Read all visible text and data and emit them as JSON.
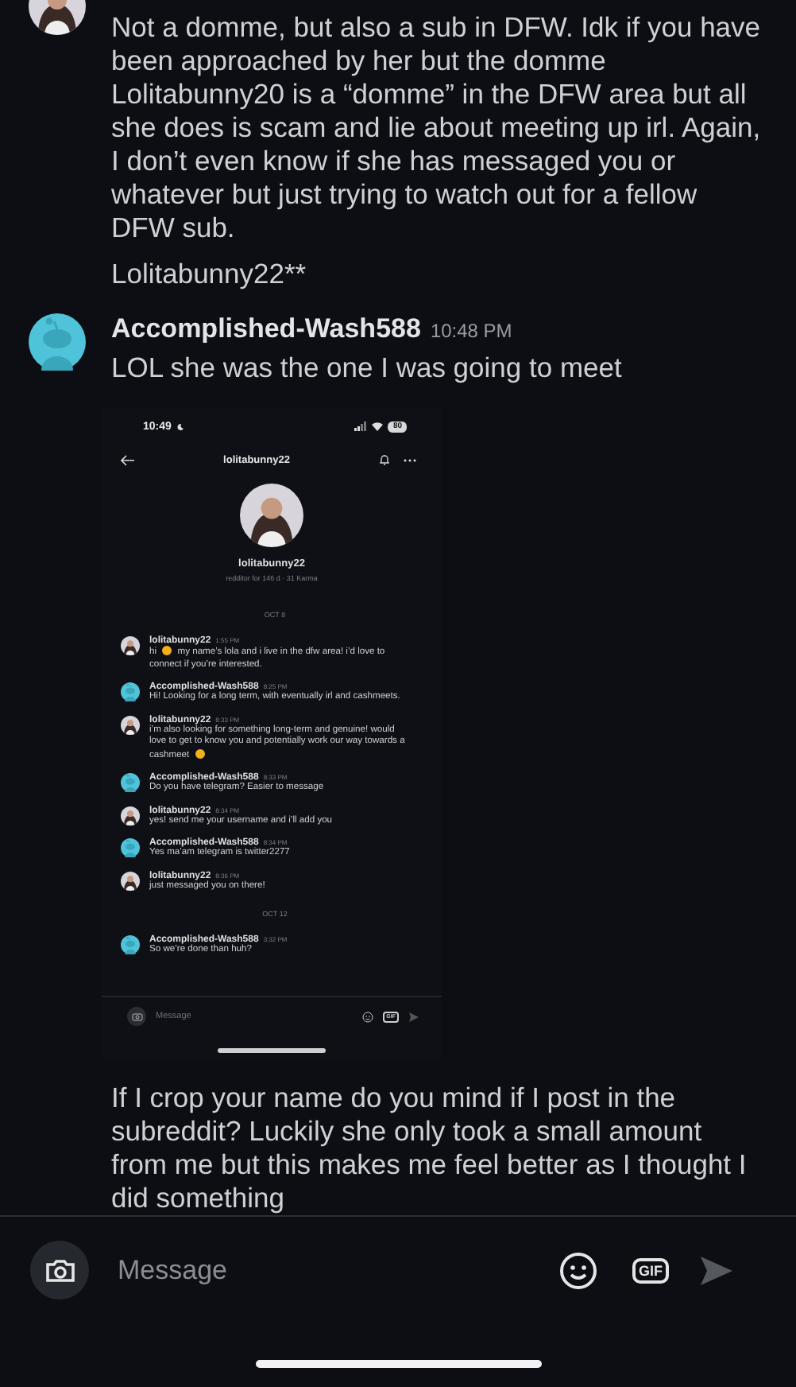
{
  "messages": [
    {
      "kind": "continued",
      "default_avatar": false,
      "paragraphs": [
        "Not a domme, but also a sub in DFW. Idk if you have been approached by her but the domme Lolitabunny20 is a “domme” in the DFW area but all she does is scam and lie about meeting up irl. Again, I don’t even know if she has messaged you or whatever but just trying to watch out for a fellow DFW sub.",
        "Lolitabunny22**"
      ]
    },
    {
      "kind": "message",
      "default_avatar": true,
      "author": "Accomplished-Wash588",
      "time": "10:48 PM",
      "paragraphs": [
        "LOL she was the one I was going to meet"
      ]
    },
    {
      "kind": "screenshot",
      "status_time": "10:49",
      "battery": "80",
      "title": "lolitabunny22",
      "profile_name": "lolitabunny22",
      "profile_meta": "redditor for 146 d · 31 Karma",
      "composer_placeholder": "Message",
      "gif_label": "GIF",
      "items": [
        {
          "kind": "date",
          "text": "OCT 8"
        },
        {
          "kind": "message",
          "default_avatar": false,
          "author": "lolitabunny22",
          "time": "1:55 PM",
          "segments": [
            {
              "kind": "text",
              "text": "hi"
            },
            {
              "kind": "emoji"
            },
            {
              "kind": "text",
              "text": "my name’s lola and i live in the dfw area! i’d love to connect if you’re interested."
            }
          ]
        },
        {
          "kind": "message",
          "default_avatar": true,
          "author": "Accomplished-Wash588",
          "time": "8:25 PM",
          "segments": [
            {
              "kind": "text",
              "text": "Hi! Looking for a long term, with eventually irl and cashmeets."
            }
          ]
        },
        {
          "kind": "message",
          "default_avatar": false,
          "author": "lolitabunny22",
          "time": "8:33 PM",
          "segments": [
            {
              "kind": "text",
              "text": "i’m also looking for something long-term and genuine! would love to get to know you and potentially work our way towards a cashmeet"
            },
            {
              "kind": "emoji"
            }
          ]
        },
        {
          "kind": "message",
          "default_avatar": true,
          "author": "Accomplished-Wash588",
          "time": "8:33 PM",
          "segments": [
            {
              "kind": "text",
              "text": "Do you have telegram? Easier to message"
            }
          ]
        },
        {
          "kind": "message",
          "default_avatar": false,
          "author": "lolitabunny22",
          "time": "8:34 PM",
          "segments": [
            {
              "kind": "text",
              "text": "yes! send me your username and i’ll add you"
            }
          ]
        },
        {
          "kind": "message",
          "default_avatar": true,
          "author": "Accomplished-Wash588",
          "time": "8:34 PM",
          "segments": [
            {
              "kind": "text",
              "text": "Yes ma’am telegram is twitter2277"
            }
          ]
        },
        {
          "kind": "message",
          "default_avatar": false,
          "author": "lolitabunny22",
          "time": "8:36 PM",
          "segments": [
            {
              "kind": "text",
              "text": "just messaged you on there!"
            }
          ]
        },
        {
          "kind": "date",
          "text": "OCT 12"
        },
        {
          "kind": "message",
          "default_avatar": true,
          "author": "Accomplished-Wash588",
          "time": "3:32 PM",
          "segments": [
            {
              "kind": "text",
              "text": "So we’re done than huh?"
            }
          ]
        }
      ]
    },
    {
      "kind": "text_only",
      "paragraphs": [
        "If I crop your name do you mind if I post in the subreddit? Luckily she only took a small amount from me but this makes me feel better as I thought I did something"
      ]
    }
  ],
  "composer": {
    "placeholder": "Message",
    "gif_label": "GIF",
    "send_disabled": true
  }
}
